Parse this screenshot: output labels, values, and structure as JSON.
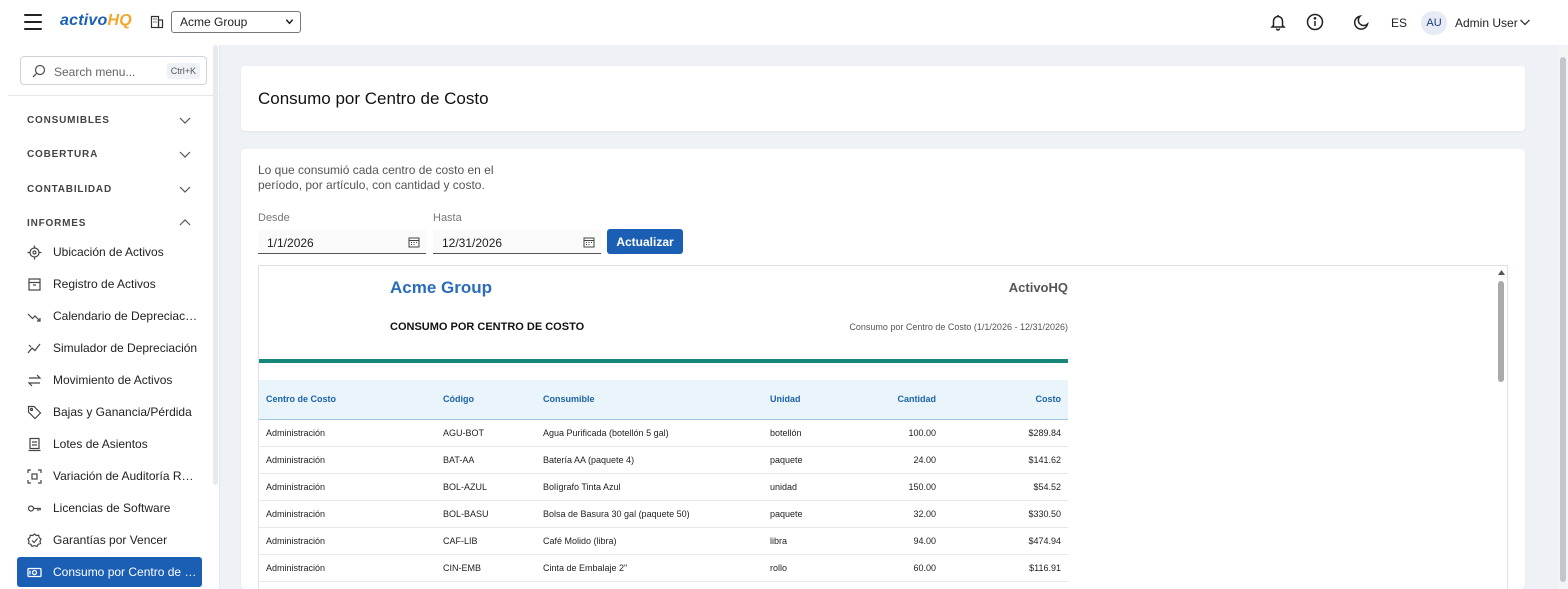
{
  "header": {
    "logo_part1": "activo",
    "logo_part2": "HQ",
    "org_select_value": "Acme Group",
    "language": "ES",
    "avatar_initials": "AU",
    "user_name": "Admin User",
    "icons": [
      "menu-icon",
      "building-icon",
      "bell-icon",
      "info-icon",
      "moon-icon",
      "chevron-down-icon"
    ]
  },
  "sidebar": {
    "search_placeholder": "Search menu...",
    "search_shortcut": "Ctrl+K",
    "sections": [
      {
        "label": "CONSUMIBLES",
        "expanded": false
      },
      {
        "label": "COBERTURA",
        "expanded": false
      },
      {
        "label": "CONTABILIDAD",
        "expanded": false
      },
      {
        "label": "INFORMES",
        "expanded": true
      }
    ],
    "items": [
      {
        "label": "Ubicación de Activos",
        "icon": "location-icon"
      },
      {
        "label": "Registro de Activos",
        "icon": "archive-icon"
      },
      {
        "label": "Calendario de Depreciación",
        "icon": "trend-down-icon"
      },
      {
        "label": "Simulador de Depreciación",
        "icon": "chart-line-icon"
      },
      {
        "label": "Movimiento de Activos",
        "icon": "arrows-exchange-icon"
      },
      {
        "label": "Bajas y Ganancia/Pérdida",
        "icon": "tag-icon"
      },
      {
        "label": "Lotes de Asientos",
        "icon": "ledger-icon"
      },
      {
        "label": "Variación de Auditoría RFID",
        "icon": "rfid-scan-icon"
      },
      {
        "label": "Licencias de Software",
        "icon": "key-icon"
      },
      {
        "label": "Garantías por Vencer",
        "icon": "badge-check-icon"
      },
      {
        "label": "Consumo por Centro de Costo",
        "icon": "cash-icon",
        "active": true
      }
    ]
  },
  "page": {
    "title": "Consumo por Centro de Costo",
    "description": "Lo que consumió cada centro de costo en el período, por artículo, con cantidad y costo.",
    "from_label": "Desde",
    "from_value": "1/1/2026",
    "to_label": "Hasta",
    "to_value": "12/31/2026",
    "update_button": "Actualizar"
  },
  "report": {
    "org_name": "Acme Group",
    "brand": "ActivoHQ",
    "title": "CONSUMO POR CENTRO DE COSTO",
    "subtitle": "Consumo por Centro de Costo (1/1/2026 - 12/31/2026)",
    "columns": [
      "Centro de Costo",
      "Código",
      "Consumible",
      "Unidad",
      "Cantidad",
      "Costo"
    ],
    "rows": [
      [
        "Administración",
        "AGU-BOT",
        "Agua Purificada (botellón 5 gal)",
        "botellón",
        "100.00",
        "$289.84"
      ],
      [
        "Administración",
        "BAT-AA",
        "Batería AA (paquete 4)",
        "paquete",
        "24.00",
        "$141.62"
      ],
      [
        "Administración",
        "BOL-AZUL",
        "Bolígrafo Tinta Azul",
        "unidad",
        "150.00",
        "$54.52"
      ],
      [
        "Administración",
        "BOL-BASU",
        "Bolsa de Basura 30 gal (paquete 50)",
        "paquete",
        "32.00",
        "$330.50"
      ],
      [
        "Administración",
        "CAF-LIB",
        "Café Molido (libra)",
        "libra",
        "94.00",
        "$474.94"
      ],
      [
        "Administración",
        "CIN-EMB",
        "Cinta de Embalaje 2\"",
        "rollo",
        "60.00",
        "$116.91"
      ]
    ]
  }
}
